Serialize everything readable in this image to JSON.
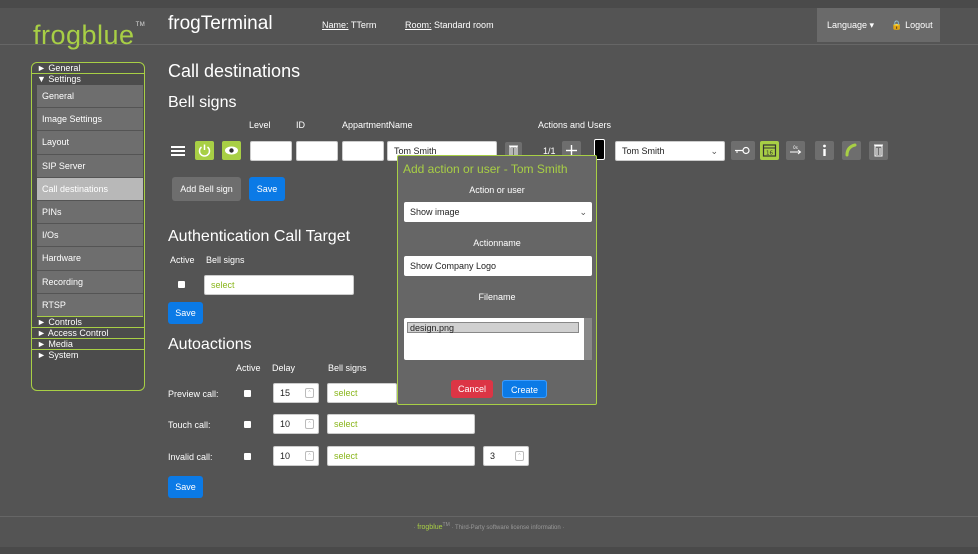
{
  "header": {
    "logo": "frogblue",
    "logo_tm": "TM",
    "app_title": "frogTerminal",
    "name_label": "Name:",
    "name_value": "TTerm",
    "room_label": "Room:",
    "room_value": "Standard room",
    "language_label": "Language",
    "logout_label": "Logout"
  },
  "sidebar": {
    "general_cat": "► General",
    "settings_cat": "▼ Settings",
    "items": [
      "General",
      "Image Settings",
      "Layout",
      "SIP Server",
      "Call destinations",
      "PINs",
      "I/Os",
      "Hardware",
      "Recording",
      "RTSP"
    ],
    "active_item": "Call destinations",
    "controls_cat": "► Controls",
    "access_cat": "► Access Control",
    "media_cat": "► Media",
    "system_cat": "► System"
  },
  "page": {
    "title": "Call destinations",
    "bell_signs": {
      "heading": "Bell signs",
      "col_level": "Level",
      "col_id": "ID",
      "col_apartment": "AppartmentName",
      "col_actions": "Actions and Users",
      "name_value": "Tom Smith",
      "counter": "1/1",
      "user_select": "Tom Smith",
      "add_button": "Add Bell sign",
      "save_button": "Save"
    },
    "auth": {
      "heading": "Authentication Call Target",
      "col_active": "Active",
      "col_bell": "Bell signs",
      "select_value": "select",
      "save_button": "Save"
    },
    "autoactions": {
      "heading": "Autoactions",
      "col_active": "Active",
      "col_delay": "Delay",
      "col_bell": "Bell signs",
      "rows": [
        {
          "label": "Preview call:",
          "delay": "15",
          "bell": "select"
        },
        {
          "label": "Touch call:",
          "delay": "10",
          "bell": "select"
        },
        {
          "label": "Invalid call:",
          "delay": "10",
          "bell": "select",
          "extra": "3"
        }
      ],
      "save_button": "Save"
    }
  },
  "modal": {
    "title": "Add action or user - Tom Smith",
    "action_label": "Action or user",
    "action_value": "Show image",
    "actionname_label": "Actionname",
    "actionname_value": "Show Company Logo",
    "filename_label": "Filename",
    "file_option": "design.png",
    "cancel_button": "Cancel",
    "create_button": "Create"
  },
  "footer": {
    "brand": "frogblue",
    "brand_tm": "TM",
    "license_text": "Third-Party software license information"
  },
  "colors": {
    "accent_green": "#a8cf45",
    "primary_blue": "#0b7ae6",
    "danger_red": "#dc3545"
  }
}
